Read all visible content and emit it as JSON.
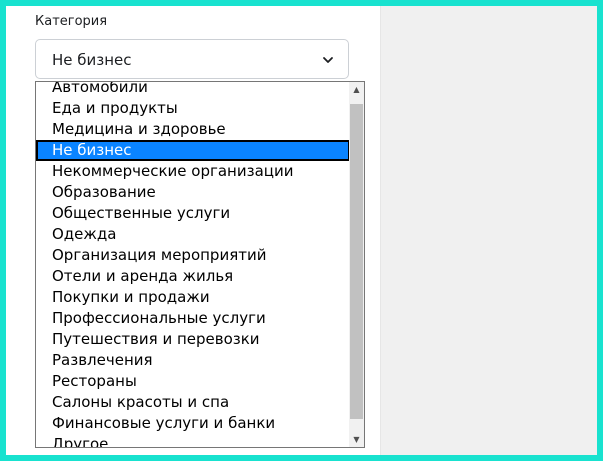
{
  "field": {
    "label": "Категория",
    "selected_value": "Не бизнес"
  },
  "icons": {
    "chevron": "chevron-down-icon",
    "scroll_up": "scroll-up-arrow",
    "scroll_down": "scroll-down-arrow"
  },
  "dropdown": {
    "options": [
      "Автомобили",
      "Еда и продукты",
      "Медицина и здоровье",
      "Не бизнес",
      "Некоммерческие организации",
      "Образование",
      "Общественные услуги",
      "Одежда",
      "Организация мероприятий",
      "Отели и аренда жилья",
      "Покупки и продажи",
      "Профессиональные услуги",
      "Путешествия и перевозки",
      "Развлечения",
      "Рестораны",
      "Салоны красоты и спа",
      "Финансовые услуги и банки",
      "Другое"
    ],
    "highlighted_option": "Не бизнес"
  },
  "colors": {
    "frame_border": "#18e2cf",
    "highlight": "#0a84ff",
    "right_panel": "#f0f0f0"
  }
}
